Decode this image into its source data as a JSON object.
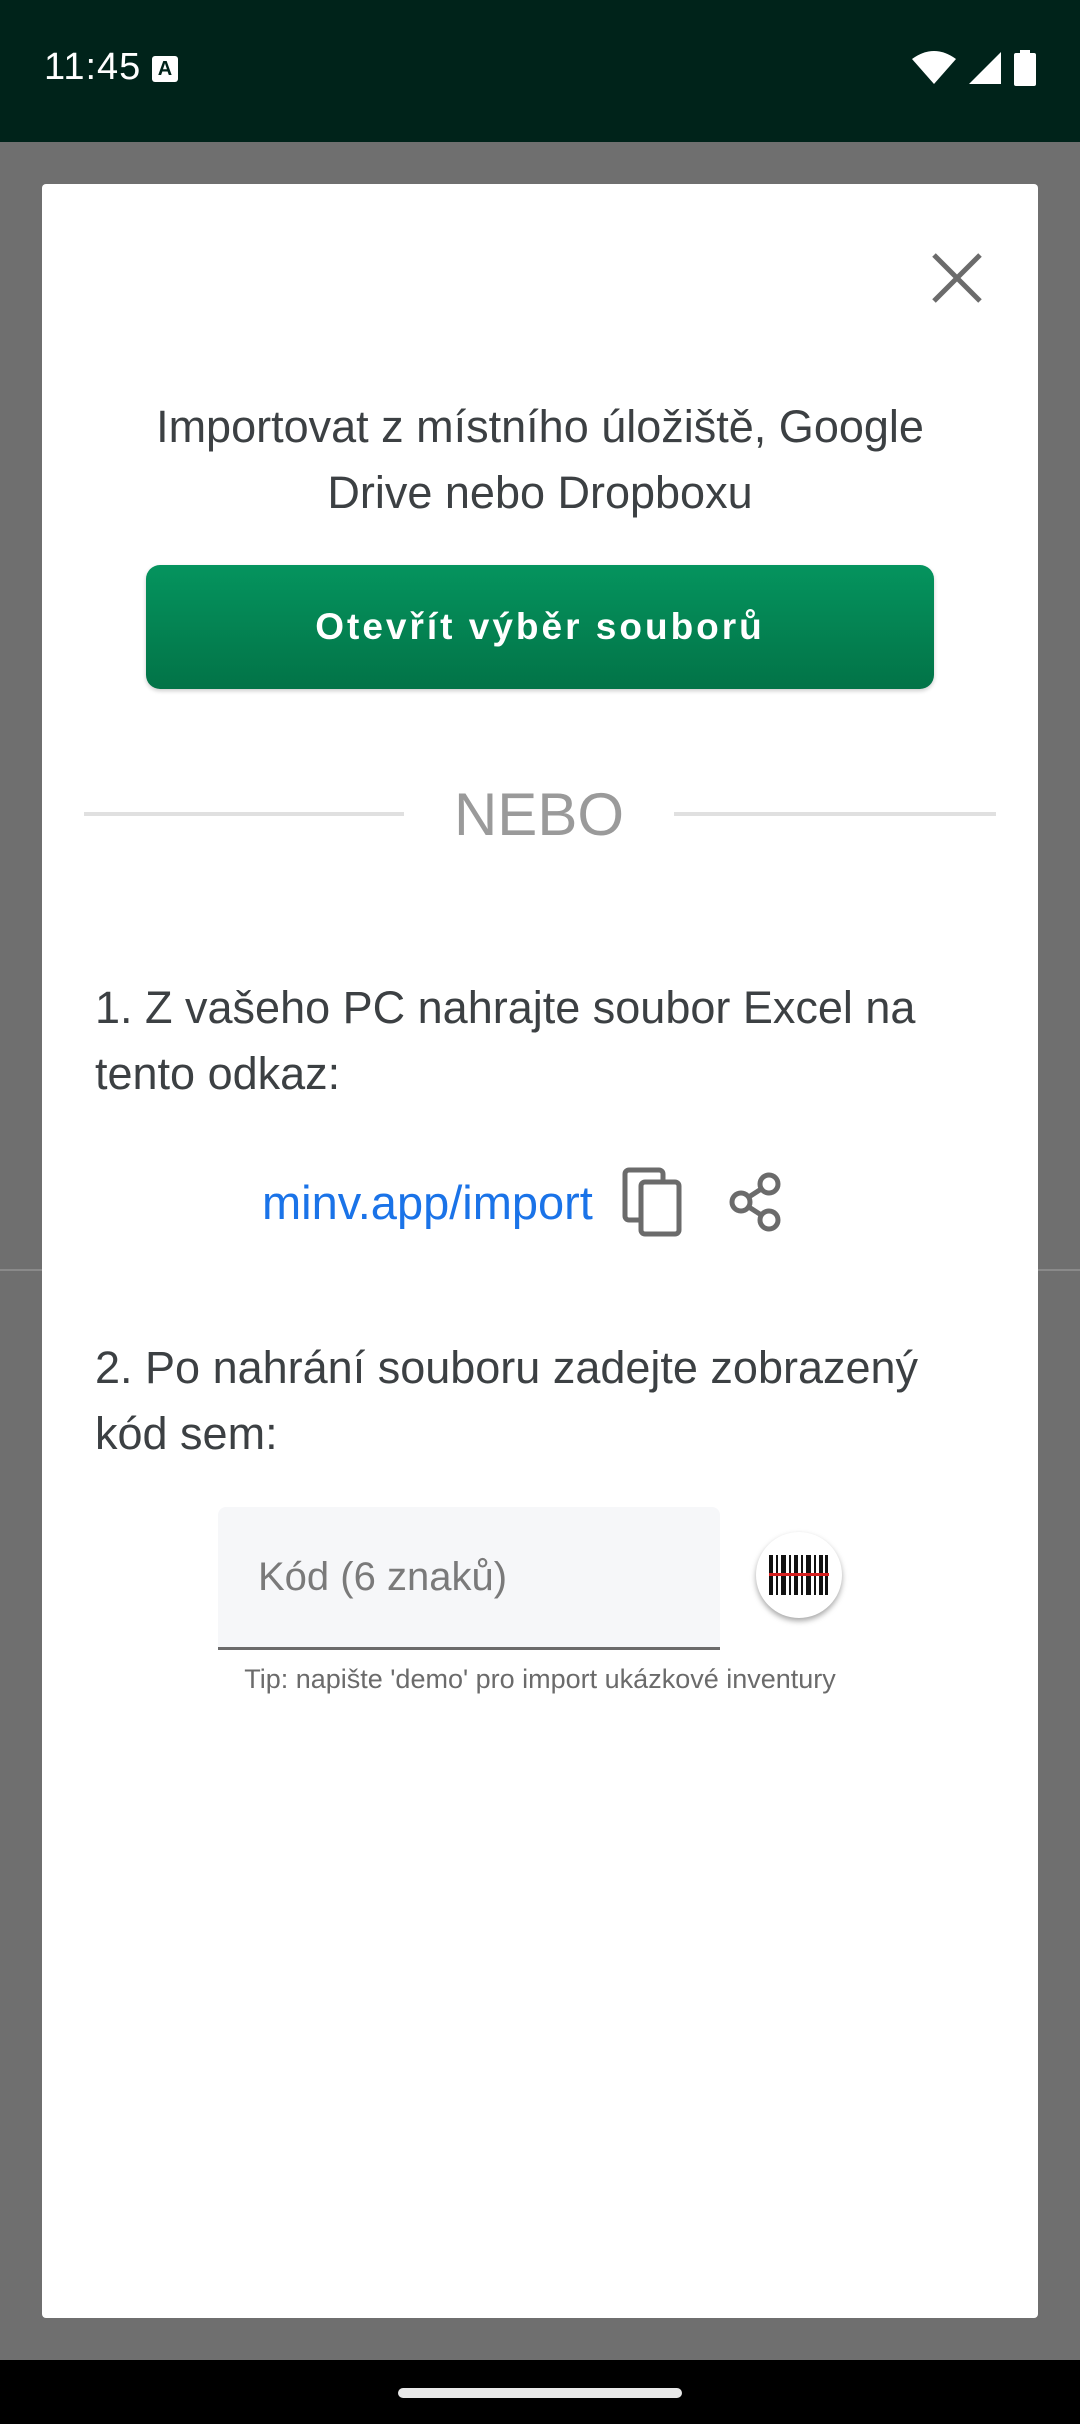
{
  "status_bar": {
    "time": "11:45",
    "notification_icon": "A",
    "icons": [
      "wifi-icon",
      "signal-icon",
      "battery-icon"
    ]
  },
  "dialog": {
    "close_icon": "close-icon",
    "intro": "Importovat z místního úložiště, Google Drive nebo Dropboxu",
    "open_files_button": "Otevřít výběr souborů",
    "divider_text": "NEBO",
    "step1": "1. Z vašeho PC nahrajte soubor Excel na tento odkaz:",
    "link": "minv.app/import",
    "step2": "2. Po nahrání souboru zadejte zobrazený kód sem:",
    "code_input": {
      "value": "",
      "placeholder": "Kód (6 znaků)"
    },
    "tip": "Tip: napište 'demo' pro import ukázkové inventury"
  },
  "colors": {
    "status_bar_bg": "#00231a",
    "primary_button": "#05945e",
    "link": "#1a73e8",
    "scrim": "#6f6f6f"
  }
}
